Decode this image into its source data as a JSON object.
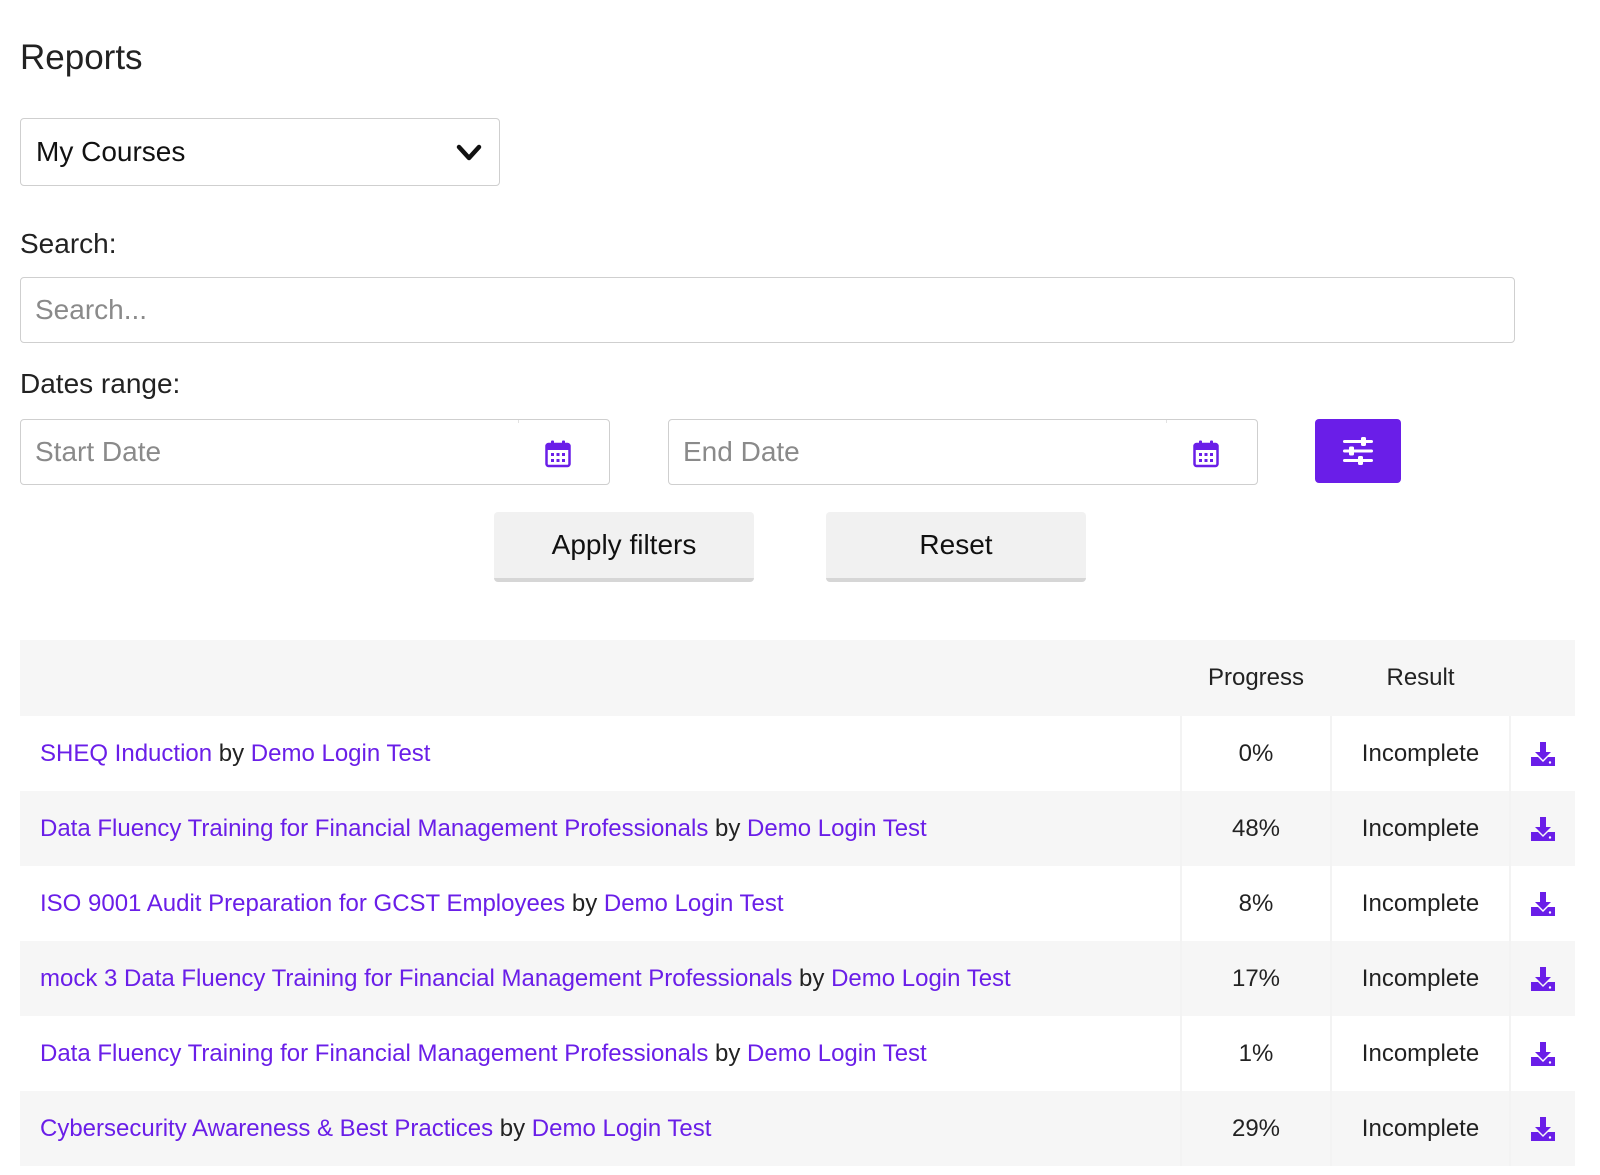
{
  "page": {
    "title": "Reports"
  },
  "report_select": {
    "value": "My Courses"
  },
  "search": {
    "label": "Search:",
    "placeholder": "Search..."
  },
  "dates": {
    "label": "Dates range:",
    "start_placeholder": "Start Date",
    "end_placeholder": "End Date"
  },
  "actions": {
    "apply_label": "Apply filters",
    "reset_label": "Reset"
  },
  "table": {
    "headers": {
      "name": "",
      "progress": "Progress",
      "result": "Result"
    },
    "by_word": "by",
    "rows": [
      {
        "course": "SHEQ Induction",
        "author": "Demo Login Test",
        "progress": "0%",
        "result": "Incomplete"
      },
      {
        "course": "Data Fluency Training for Financial Management Professionals",
        "author": "Demo Login Test",
        "progress": "48%",
        "result": "Incomplete"
      },
      {
        "course": "ISO 9001 Audit Preparation for GCST Employees",
        "author": "Demo Login Test",
        "progress": "8%",
        "result": "Incomplete"
      },
      {
        "course": "mock 3 Data Fluency Training for Financial Management Professionals",
        "author": "Demo Login Test",
        "progress": "17%",
        "result": "Incomplete"
      },
      {
        "course": "Data Fluency Training for Financial Management Professionals",
        "author": "Demo Login Test",
        "progress": "1%",
        "result": "Incomplete"
      },
      {
        "course": "Cybersecurity Awareness & Best Practices",
        "author": "Demo Login Test",
        "progress": "29%",
        "result": "Incomplete"
      }
    ]
  },
  "theme": {
    "accent": "#6a1ee8"
  }
}
